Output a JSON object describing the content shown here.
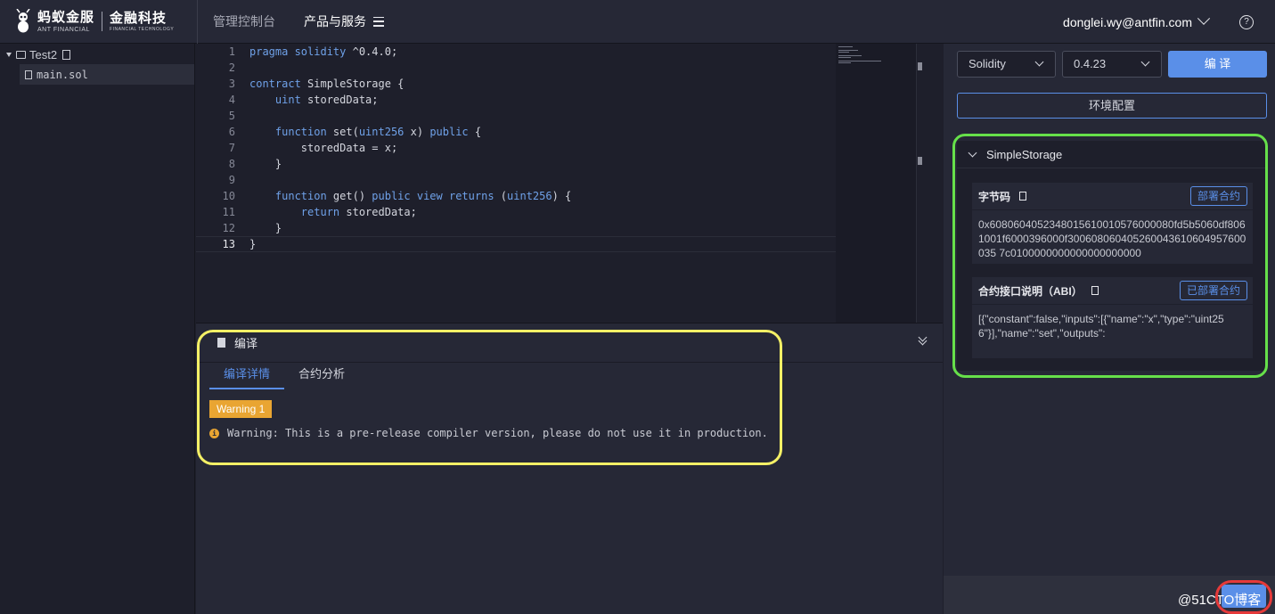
{
  "brand": {
    "logo_cn": "蚂蚁金服",
    "logo_en": "ANT FINANCIAL",
    "logo2_cn": "金融科技",
    "logo2_en": "FINANCIAL TECHNOLOGY"
  },
  "nav": {
    "items": [
      "管理控制台",
      "产品与服务"
    ]
  },
  "user": {
    "email": "donglei.wy@antfin.com",
    "help": "?"
  },
  "file_tree": {
    "folder": "Test2",
    "file": "main.sol"
  },
  "editor": {
    "line_numbers": [
      "1",
      "2",
      "3",
      "4",
      "5",
      "6",
      "7",
      "8",
      "9",
      "10",
      "11",
      "12",
      "13"
    ],
    "current_line": "13"
  },
  "compile_panel": {
    "title": "编译",
    "tabs": [
      "编译详情",
      "合约分析"
    ],
    "warning_badge": "Warning 1",
    "warning_icon": "i",
    "warning_text": "Warning: This is a pre-release compiler version, please do not use it in production."
  },
  "right_panel": {
    "language": "Solidity",
    "version": "0.4.23",
    "compile_label": "编 译",
    "env_label": "环境配置",
    "contract_name": "SimpleStorage",
    "bytecode_label": "字节码",
    "deploy_label": "部署合约",
    "bytecode": "0x6080604052348015610010576000080fd5b5060df8061001f6000396000f300608060405260043610604957600035 7c0100000000000000000000",
    "abi_label": "合约接口说明（ABI）",
    "deployed_label": "已部署合约",
    "abi": "[{\"constant\":false,\"inputs\":[{\"name\":\"x\",\"type\":\"uint256\"}],\"name\":\"set\",\"outputs\":"
  },
  "watermark": "@51CTO博客"
}
